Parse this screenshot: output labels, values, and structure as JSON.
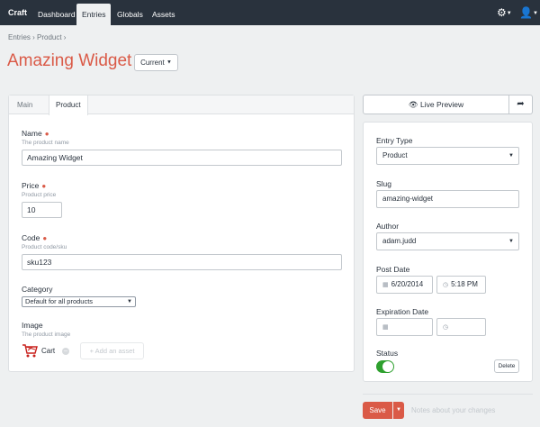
{
  "nav": {
    "brand": "Craft",
    "items": [
      {
        "label": "Dashboard"
      },
      {
        "label": "Entries"
      },
      {
        "label": "Globals"
      },
      {
        "label": "Assets"
      }
    ],
    "active": "Entries"
  },
  "breadcrumb": "Entries › Product ›",
  "page_title": "Amazing Widget",
  "revision": "Current",
  "tabs": [
    {
      "label": "Main"
    },
    {
      "label": "Product"
    }
  ],
  "fields": {
    "name": {
      "label": "Name",
      "hint": "The product name",
      "value": "Amazing Widget"
    },
    "price": {
      "label": "Price",
      "hint": "Product price",
      "value": "10"
    },
    "code": {
      "label": "Code",
      "hint": "Product code/sku",
      "value": "sku123"
    },
    "category": {
      "label": "Category",
      "value": "Default for all products"
    },
    "image": {
      "label": "Image",
      "hint": "The product image",
      "asset": "Cart",
      "add_label": "Add an asset"
    }
  },
  "side": {
    "live_preview": "Live Preview",
    "entry_type": {
      "label": "Entry Type",
      "value": "Product"
    },
    "slug": {
      "label": "Slug",
      "value": "amazing-widget"
    },
    "author": {
      "label": "Author",
      "value": "adam.judd"
    },
    "post_date": {
      "label": "Post Date",
      "date": "6/20/2014",
      "time": "5:18 PM"
    },
    "expiration": {
      "label": "Expiration Date",
      "date": "",
      "time": ""
    },
    "status": {
      "label": "Status",
      "enabled": true
    },
    "delete_label": "Delete"
  },
  "save": {
    "label": "Save",
    "notes_placeholder": "Notes about your changes"
  },
  "colors": {
    "accent": "#da5a47",
    "nav": "#29323d",
    "toggle_on": "#2ea02e"
  }
}
